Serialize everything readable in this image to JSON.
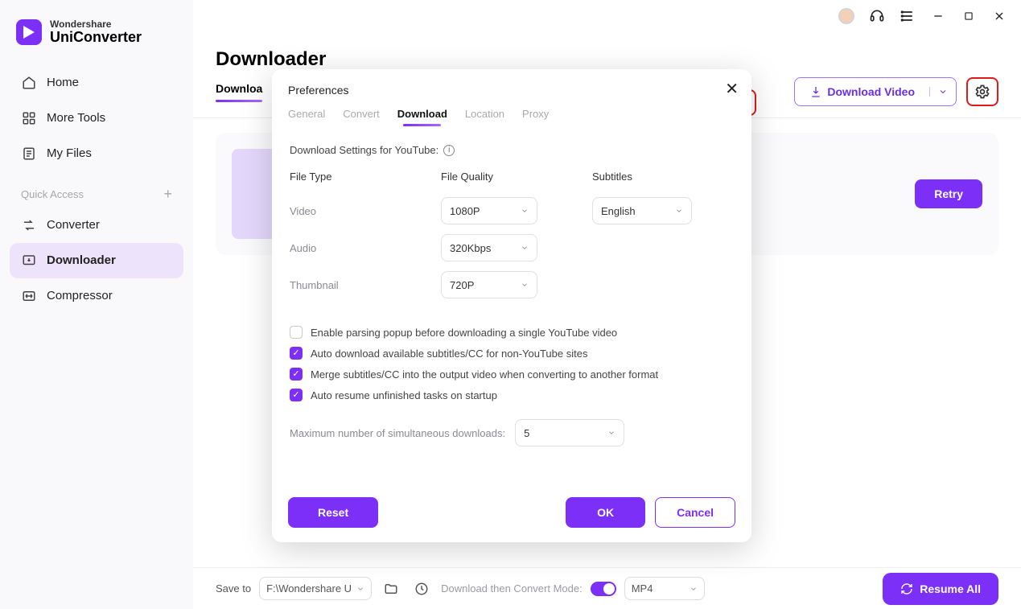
{
  "app": {
    "brand1": "Wondershare",
    "brand2": "UniConverter"
  },
  "sidebar": {
    "items": [
      {
        "label": "Home"
      },
      {
        "label": "More Tools"
      },
      {
        "label": "My Files"
      }
    ],
    "quick_label": "Quick Access",
    "quick_items": [
      {
        "label": "Converter"
      },
      {
        "label": "Downloader"
      },
      {
        "label": "Compressor"
      }
    ]
  },
  "page": {
    "title": "Downloader"
  },
  "tabs": {
    "downloading": "Downloa"
  },
  "toolbar": {
    "download_video": "Download Video"
  },
  "card": {
    "retry": "Retry"
  },
  "footer": {
    "save_to": "Save to",
    "path": "F:\\Wondershare U",
    "convert_mode": "Download then Convert Mode:",
    "format": "MP4",
    "resume": "Resume All"
  },
  "modal": {
    "title": "Preferences",
    "tabs": [
      "General",
      "Convert",
      "Download",
      "Location",
      "Proxy"
    ],
    "active_tab": "Download",
    "section_title": "Download Settings for YouTube:",
    "cols": {
      "type": "File Type",
      "quality": "File Quality",
      "subs": "Subtitles"
    },
    "rows": {
      "video": {
        "label": "Video",
        "quality": "1080P",
        "sub": "English"
      },
      "audio": {
        "label": "Audio",
        "quality": "320Kbps"
      },
      "thumb": {
        "label": "Thumbnail",
        "quality": "720P"
      }
    },
    "checks": [
      {
        "checked": false,
        "label": "Enable parsing popup before downloading a single YouTube video"
      },
      {
        "checked": true,
        "label": "Auto download available subtitles/CC for non-YouTube sites"
      },
      {
        "checked": true,
        "label": "Merge subtitles/CC into the output video when converting to another format"
      },
      {
        "checked": true,
        "label": "Auto resume unfinished tasks on startup"
      }
    ],
    "sim_label": "Maximum number of simultaneous downloads:",
    "sim_value": "5",
    "buttons": {
      "reset": "Reset",
      "ok": "OK",
      "cancel": "Cancel"
    }
  }
}
